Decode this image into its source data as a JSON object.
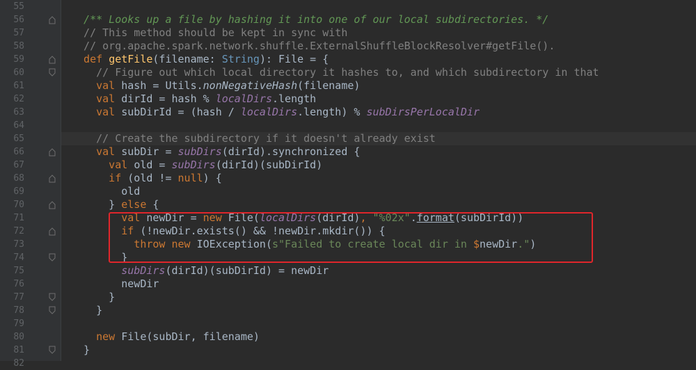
{
  "editor": {
    "lines": [
      {
        "n": "55",
        "segments": []
      },
      {
        "n": "56",
        "segments": [
          {
            "t": "doc",
            "v": "  /** Looks up a file by hashing it into one of our local subdirectories. */"
          }
        ]
      },
      {
        "n": "57",
        "segments": [
          {
            "t": "cm",
            "v": "  // This method should be kept in sync with"
          }
        ]
      },
      {
        "n": "58",
        "segments": [
          {
            "t": "cm",
            "v": "  // org.apache.spark.network.shuffle.ExternalShuffleBlockResolver#getFile()."
          }
        ]
      },
      {
        "n": "59",
        "segments": [
          {
            "t": "kwn",
            "v": "  def "
          },
          {
            "t": "fn",
            "v": "getFile"
          },
          {
            "t": "ident",
            "v": "(filename: "
          },
          {
            "t": "ty",
            "v": "String"
          },
          {
            "t": "ident",
            "v": "): File = {"
          }
        ]
      },
      {
        "n": "60",
        "segments": [
          {
            "t": "cm",
            "v": "    // Figure out which local directory it hashes to, and which subdirectory in that"
          }
        ]
      },
      {
        "n": "61",
        "segments": [
          {
            "t": "kwn",
            "v": "    val "
          },
          {
            "t": "ident",
            "v": "hash = Utils."
          },
          {
            "t": "it",
            "v": "nonNegativeHash"
          },
          {
            "t": "ident",
            "v": "(filename)"
          }
        ]
      },
      {
        "n": "62",
        "segments": [
          {
            "t": "kwn",
            "v": "    val "
          },
          {
            "t": "ident",
            "v": "dirId = hash % "
          },
          {
            "t": "fld",
            "v": "localDirs"
          },
          {
            "t": "ident",
            "v": ".length"
          }
        ]
      },
      {
        "n": "63",
        "segments": [
          {
            "t": "kwn",
            "v": "    val "
          },
          {
            "t": "ident",
            "v": "subDirId = (hash / "
          },
          {
            "t": "fld",
            "v": "localDirs"
          },
          {
            "t": "ident",
            "v": ".length) % "
          },
          {
            "t": "fld",
            "v": "subDirsPerLocalDir"
          }
        ]
      },
      {
        "n": "64",
        "segments": []
      },
      {
        "n": "65",
        "segments": [
          {
            "t": "cm",
            "v": "    // Create the subdirectory if it doesn't already exist"
          }
        ]
      },
      {
        "n": "66",
        "segments": [
          {
            "t": "kwn",
            "v": "    val "
          },
          {
            "t": "ident",
            "v": "subDir = "
          },
          {
            "t": "fld",
            "v": "subDirs"
          },
          {
            "t": "ident",
            "v": "(dirId).synchronized {"
          }
        ]
      },
      {
        "n": "67",
        "segments": [
          {
            "t": "kwn",
            "v": "      val "
          },
          {
            "t": "ident",
            "v": "old = "
          },
          {
            "t": "fld",
            "v": "subDirs"
          },
          {
            "t": "ident",
            "v": "(dirId)(subDirId)"
          }
        ]
      },
      {
        "n": "68",
        "segments": [
          {
            "t": "kwn",
            "v": "      if "
          },
          {
            "t": "ident",
            "v": "(old != "
          },
          {
            "t": "kwn",
            "v": "null"
          },
          {
            "t": "ident",
            "v": ") {"
          }
        ]
      },
      {
        "n": "69",
        "segments": [
          {
            "t": "ident",
            "v": "        old"
          }
        ]
      },
      {
        "n": "70",
        "segments": [
          {
            "t": "ident",
            "v": "      } "
          },
          {
            "t": "kwn",
            "v": "else "
          },
          {
            "t": "ident",
            "v": "{"
          }
        ]
      },
      {
        "n": "71",
        "segments": [
          {
            "t": "kwn",
            "v": "        val "
          },
          {
            "t": "ident",
            "v": "newDir = "
          },
          {
            "t": "kwn",
            "v": "new "
          },
          {
            "t": "ident",
            "v": "File("
          },
          {
            "t": "fld",
            "v": "localDirs"
          },
          {
            "t": "ident",
            "v": "(dirId)"
          },
          {
            "t": "kwn",
            "v": ", "
          },
          {
            "t": "str",
            "v": "\"%02x\""
          },
          {
            "t": "ident",
            "v": "."
          },
          {
            "t": "ul",
            "v": "format"
          },
          {
            "t": "ident",
            "v": "(subDirId))"
          }
        ]
      },
      {
        "n": "72",
        "segments": [
          {
            "t": "kwn",
            "v": "        if "
          },
          {
            "t": "ident",
            "v": "(!newDir.exists() && !newDir.mkdir()) {"
          }
        ]
      },
      {
        "n": "73",
        "segments": [
          {
            "t": "kwn",
            "v": "          throw new "
          },
          {
            "t": "ident",
            "v": "IOException("
          },
          {
            "t": "str",
            "v": "s\"Failed to create local dir in "
          },
          {
            "t": "dollar",
            "v": "$"
          },
          {
            "t": "ident",
            "v": "newDir"
          },
          {
            "t": "str",
            "v": ".\""
          },
          {
            "t": "ident",
            "v": ")"
          }
        ]
      },
      {
        "n": "74",
        "segments": [
          {
            "t": "ident",
            "v": "        }"
          }
        ]
      },
      {
        "n": "75",
        "segments": [
          {
            "t": "fld",
            "v": "        subDirs"
          },
          {
            "t": "ident",
            "v": "(dirId)(subDirId) = newDir"
          }
        ]
      },
      {
        "n": "76",
        "segments": [
          {
            "t": "ident",
            "v": "        newDir"
          }
        ]
      },
      {
        "n": "77",
        "segments": [
          {
            "t": "ident",
            "v": "      }"
          }
        ]
      },
      {
        "n": "78",
        "segments": [
          {
            "t": "ident",
            "v": "    }"
          }
        ]
      },
      {
        "n": "79",
        "segments": []
      },
      {
        "n": "80",
        "segments": [
          {
            "t": "kwn",
            "v": "    new "
          },
          {
            "t": "ident",
            "v": "File(subDir, filename)"
          }
        ]
      },
      {
        "n": "81",
        "segments": [
          {
            "t": "ident",
            "v": "  }"
          }
        ]
      },
      {
        "n": "82",
        "segments": []
      }
    ]
  },
  "colors": {
    "background": "#2b2b2b",
    "gutter": "#313335",
    "keyword": "#cc7832",
    "function": "#ffc66d",
    "comment": "#808080",
    "doc_comment": "#629755",
    "string": "#6a8759",
    "field": "#9876aa",
    "type": "#6897bb",
    "highlight_box": "#e0262b"
  }
}
